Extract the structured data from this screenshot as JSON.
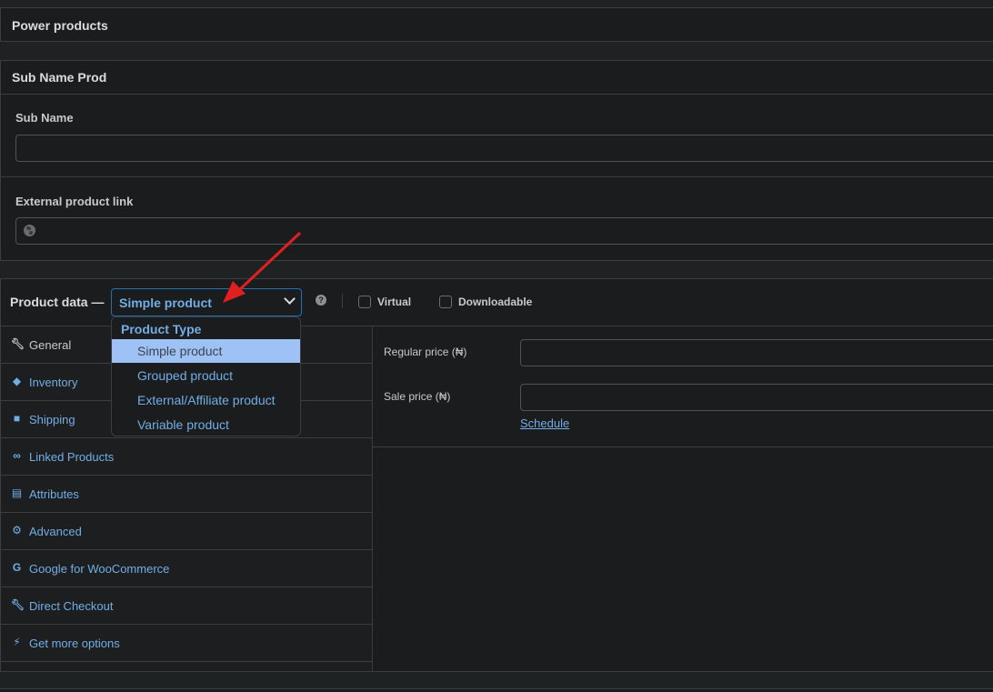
{
  "power_products": {
    "title": "Power products"
  },
  "sub_name_prod": {
    "title": "Sub Name Prod",
    "sub_name": {
      "label": "Sub Name",
      "value": "",
      "placeholder": ""
    },
    "external_link": {
      "label": "External product link",
      "value": "",
      "icon": "globe-icon"
    }
  },
  "product_data": {
    "title": "Product data —",
    "type_select": {
      "value": "Simple product"
    },
    "help_icon": "?",
    "virtual": {
      "label": "Virtual",
      "checked": false
    },
    "downloadable": {
      "label": "Downloadable",
      "checked": false
    },
    "dropdown": {
      "group": "Product Type",
      "options": [
        {
          "label": "Simple product",
          "selected": true
        },
        {
          "label": "Grouped product",
          "selected": false
        },
        {
          "label": "External/Affiliate product",
          "selected": false
        },
        {
          "label": "Variable product",
          "selected": false
        }
      ]
    },
    "tabs": [
      {
        "label": "General",
        "icon": "wrench-icon",
        "active": true
      },
      {
        "label": "Inventory",
        "icon": "tag-icon",
        "active": false
      },
      {
        "label": "Shipping",
        "icon": "truck-icon",
        "active": false
      },
      {
        "label": "Linked Products",
        "icon": "link-icon",
        "active": false
      },
      {
        "label": "Attributes",
        "icon": "list-icon",
        "active": false
      },
      {
        "label": "Advanced",
        "icon": "gear-icon",
        "active": false
      },
      {
        "label": "Google for WooCommerce",
        "icon": "google-icon",
        "active": false
      },
      {
        "label": "Direct Checkout",
        "icon": "wrench-icon",
        "active": false
      },
      {
        "label": "Get more options",
        "icon": "plug-icon",
        "active": false
      }
    ],
    "general": {
      "regular_price": {
        "label": "Regular price (₦)",
        "value": ""
      },
      "sale_price": {
        "label": "Sale price (₦)",
        "value": ""
      },
      "schedule_link": "Schedule"
    }
  },
  "annotation": {
    "color": "#e02020"
  }
}
